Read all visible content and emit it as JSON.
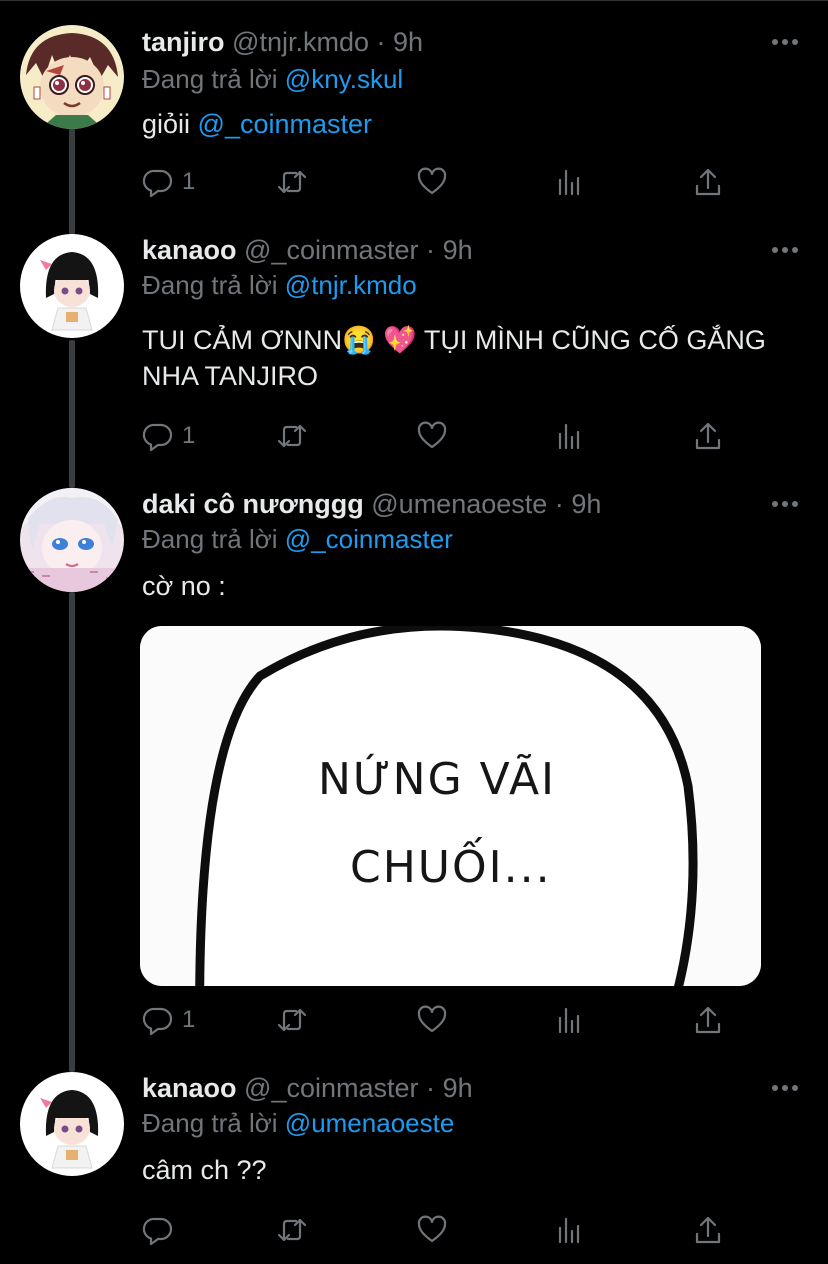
{
  "tweets": [
    {
      "name": "tanjiro",
      "handle": "@tnjr.kmdo",
      "dot": "·",
      "time": "9h",
      "reply_prefix": "Đang trả lời",
      "reply_to": "@kny.skul",
      "text_plain": "giỏii",
      "text_mention": "@_coinmaster",
      "text_after": "",
      "reply_count": "1",
      "avatar": "tanjiro-avatar"
    },
    {
      "name": "kanaoo",
      "handle": "@_coinmaster",
      "dot": "·",
      "time": "9h",
      "reply_prefix": "Đang trả lời",
      "reply_to": "@tnjr.kmdo",
      "text_plain": "TUI CẢM ƠNNN😭 💖 TỤI MÌNH CŨNG CỐ GẮNG NHA TANJIRO",
      "text_mention": "",
      "text_after": "",
      "reply_count": "1",
      "avatar": "kanao-avatar"
    },
    {
      "name": "daki cô nươnggg",
      "handle": "@umenaoeste",
      "dot": "·",
      "time": "9h",
      "reply_prefix": "Đang trả lời",
      "reply_to": "@_coinmaster",
      "text_plain": "cờ no :",
      "text_mention": "",
      "text_after": "",
      "reply_count": "1",
      "avatar": "daki-avatar",
      "media": {
        "line1": "NỨNG VÃI",
        "line2": "CHUỐI..."
      }
    },
    {
      "name": "kanaoo",
      "handle": "@_coinmaster",
      "dot": "·",
      "time": "9h",
      "reply_prefix": "Đang trả lời",
      "reply_to": "@umenaoeste",
      "text_plain": "câm ch ??",
      "text_mention": "",
      "text_after": "",
      "reply_count": "",
      "avatar": "kanao-avatar"
    }
  ],
  "icons": [
    "reply-icon",
    "retweet-icon",
    "like-icon",
    "views-icon",
    "share-icon",
    "more-icon"
  ],
  "colors": {
    "background": "#000000",
    "text": "#e7e9ea",
    "muted": "#71767b",
    "link": "#1d9bf0",
    "thread_line": "#3a3d40"
  }
}
